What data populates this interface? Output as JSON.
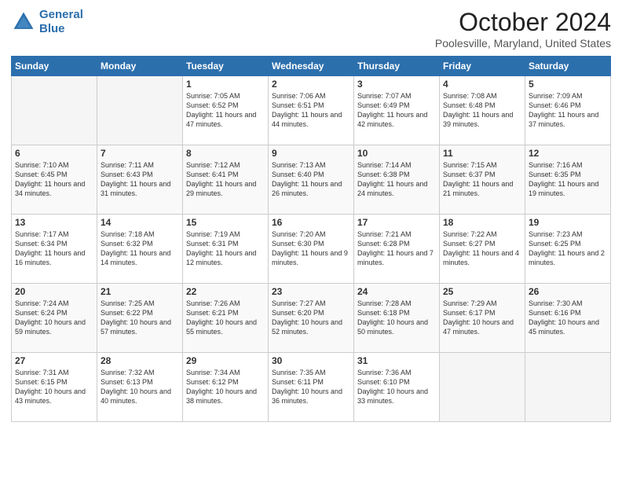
{
  "header": {
    "logo_line1": "General",
    "logo_line2": "Blue",
    "month_title": "October 2024",
    "location": "Poolesville, Maryland, United States"
  },
  "days_of_week": [
    "Sunday",
    "Monday",
    "Tuesday",
    "Wednesday",
    "Thursday",
    "Friday",
    "Saturday"
  ],
  "weeks": [
    [
      {
        "day": "",
        "empty": true
      },
      {
        "day": "",
        "empty": true
      },
      {
        "day": "1",
        "sunrise": "Sunrise: 7:05 AM",
        "sunset": "Sunset: 6:52 PM",
        "daylight": "Daylight: 11 hours and 47 minutes."
      },
      {
        "day": "2",
        "sunrise": "Sunrise: 7:06 AM",
        "sunset": "Sunset: 6:51 PM",
        "daylight": "Daylight: 11 hours and 44 minutes."
      },
      {
        "day": "3",
        "sunrise": "Sunrise: 7:07 AM",
        "sunset": "Sunset: 6:49 PM",
        "daylight": "Daylight: 11 hours and 42 minutes."
      },
      {
        "day": "4",
        "sunrise": "Sunrise: 7:08 AM",
        "sunset": "Sunset: 6:48 PM",
        "daylight": "Daylight: 11 hours and 39 minutes."
      },
      {
        "day": "5",
        "sunrise": "Sunrise: 7:09 AM",
        "sunset": "Sunset: 6:46 PM",
        "daylight": "Daylight: 11 hours and 37 minutes."
      }
    ],
    [
      {
        "day": "6",
        "sunrise": "Sunrise: 7:10 AM",
        "sunset": "Sunset: 6:45 PM",
        "daylight": "Daylight: 11 hours and 34 minutes."
      },
      {
        "day": "7",
        "sunrise": "Sunrise: 7:11 AM",
        "sunset": "Sunset: 6:43 PM",
        "daylight": "Daylight: 11 hours and 31 minutes."
      },
      {
        "day": "8",
        "sunrise": "Sunrise: 7:12 AM",
        "sunset": "Sunset: 6:41 PM",
        "daylight": "Daylight: 11 hours and 29 minutes."
      },
      {
        "day": "9",
        "sunrise": "Sunrise: 7:13 AM",
        "sunset": "Sunset: 6:40 PM",
        "daylight": "Daylight: 11 hours and 26 minutes."
      },
      {
        "day": "10",
        "sunrise": "Sunrise: 7:14 AM",
        "sunset": "Sunset: 6:38 PM",
        "daylight": "Daylight: 11 hours and 24 minutes."
      },
      {
        "day": "11",
        "sunrise": "Sunrise: 7:15 AM",
        "sunset": "Sunset: 6:37 PM",
        "daylight": "Daylight: 11 hours and 21 minutes."
      },
      {
        "day": "12",
        "sunrise": "Sunrise: 7:16 AM",
        "sunset": "Sunset: 6:35 PM",
        "daylight": "Daylight: 11 hours and 19 minutes."
      }
    ],
    [
      {
        "day": "13",
        "sunrise": "Sunrise: 7:17 AM",
        "sunset": "Sunset: 6:34 PM",
        "daylight": "Daylight: 11 hours and 16 minutes."
      },
      {
        "day": "14",
        "sunrise": "Sunrise: 7:18 AM",
        "sunset": "Sunset: 6:32 PM",
        "daylight": "Daylight: 11 hours and 14 minutes."
      },
      {
        "day": "15",
        "sunrise": "Sunrise: 7:19 AM",
        "sunset": "Sunset: 6:31 PM",
        "daylight": "Daylight: 11 hours and 12 minutes."
      },
      {
        "day": "16",
        "sunrise": "Sunrise: 7:20 AM",
        "sunset": "Sunset: 6:30 PM",
        "daylight": "Daylight: 11 hours and 9 minutes."
      },
      {
        "day": "17",
        "sunrise": "Sunrise: 7:21 AM",
        "sunset": "Sunset: 6:28 PM",
        "daylight": "Daylight: 11 hours and 7 minutes."
      },
      {
        "day": "18",
        "sunrise": "Sunrise: 7:22 AM",
        "sunset": "Sunset: 6:27 PM",
        "daylight": "Daylight: 11 hours and 4 minutes."
      },
      {
        "day": "19",
        "sunrise": "Sunrise: 7:23 AM",
        "sunset": "Sunset: 6:25 PM",
        "daylight": "Daylight: 11 hours and 2 minutes."
      }
    ],
    [
      {
        "day": "20",
        "sunrise": "Sunrise: 7:24 AM",
        "sunset": "Sunset: 6:24 PM",
        "daylight": "Daylight: 10 hours and 59 minutes."
      },
      {
        "day": "21",
        "sunrise": "Sunrise: 7:25 AM",
        "sunset": "Sunset: 6:22 PM",
        "daylight": "Daylight: 10 hours and 57 minutes."
      },
      {
        "day": "22",
        "sunrise": "Sunrise: 7:26 AM",
        "sunset": "Sunset: 6:21 PM",
        "daylight": "Daylight: 10 hours and 55 minutes."
      },
      {
        "day": "23",
        "sunrise": "Sunrise: 7:27 AM",
        "sunset": "Sunset: 6:20 PM",
        "daylight": "Daylight: 10 hours and 52 minutes."
      },
      {
        "day": "24",
        "sunrise": "Sunrise: 7:28 AM",
        "sunset": "Sunset: 6:18 PM",
        "daylight": "Daylight: 10 hours and 50 minutes."
      },
      {
        "day": "25",
        "sunrise": "Sunrise: 7:29 AM",
        "sunset": "Sunset: 6:17 PM",
        "daylight": "Daylight: 10 hours and 47 minutes."
      },
      {
        "day": "26",
        "sunrise": "Sunrise: 7:30 AM",
        "sunset": "Sunset: 6:16 PM",
        "daylight": "Daylight: 10 hours and 45 minutes."
      }
    ],
    [
      {
        "day": "27",
        "sunrise": "Sunrise: 7:31 AM",
        "sunset": "Sunset: 6:15 PM",
        "daylight": "Daylight: 10 hours and 43 minutes."
      },
      {
        "day": "28",
        "sunrise": "Sunrise: 7:32 AM",
        "sunset": "Sunset: 6:13 PM",
        "daylight": "Daylight: 10 hours and 40 minutes."
      },
      {
        "day": "29",
        "sunrise": "Sunrise: 7:34 AM",
        "sunset": "Sunset: 6:12 PM",
        "daylight": "Daylight: 10 hours and 38 minutes."
      },
      {
        "day": "30",
        "sunrise": "Sunrise: 7:35 AM",
        "sunset": "Sunset: 6:11 PM",
        "daylight": "Daylight: 10 hours and 36 minutes."
      },
      {
        "day": "31",
        "sunrise": "Sunrise: 7:36 AM",
        "sunset": "Sunset: 6:10 PM",
        "daylight": "Daylight: 10 hours and 33 minutes."
      },
      {
        "day": "",
        "empty": true
      },
      {
        "day": "",
        "empty": true
      }
    ]
  ]
}
